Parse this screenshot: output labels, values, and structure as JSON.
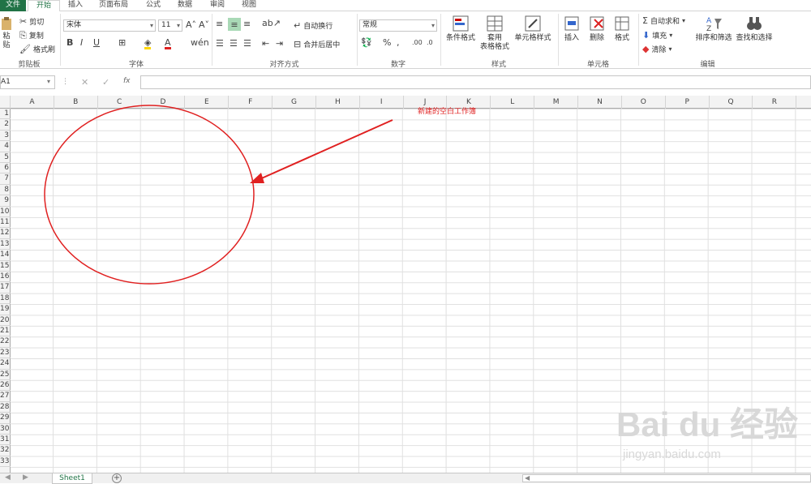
{
  "tabs": {
    "file": "文件",
    "home": "开始",
    "insert": "插入",
    "layout": "页面布局",
    "formula": "公式",
    "data": "数据",
    "review": "审阅",
    "view": "视图"
  },
  "clipboard": {
    "paste": "粘贴",
    "cut": "剪切",
    "copy": "复制",
    "painter": "格式刷",
    "group": "剪贴板"
  },
  "font": {
    "name": "宋体",
    "size": "11",
    "group": "字体"
  },
  "align": {
    "wrap": "自动换行",
    "merge": "合并后居中",
    "group": "对齐方式"
  },
  "number": {
    "format": "常规",
    "group": "数字"
  },
  "styles": {
    "cond": "条件格式",
    "table1": "套用",
    "table2": "表格格式",
    "cell": "单元格样式",
    "group": "样式"
  },
  "cells": {
    "insert": "插入",
    "delete": "删除",
    "format": "格式",
    "group": "单元格"
  },
  "edit": {
    "autosum": "自动求和",
    "fill": "填充",
    "clear": "清除",
    "sort": "排序和筛选",
    "find": "查找和选择",
    "group": "编辑"
  },
  "formula_bar": {
    "namebox": "A1",
    "fx": "fx"
  },
  "columns": [
    "A",
    "B",
    "C",
    "D",
    "E",
    "F",
    "G",
    "H",
    "I",
    "J",
    "K",
    "L",
    "M",
    "N",
    "O",
    "P",
    "Q",
    "R"
  ],
  "rows": [
    "1",
    "2",
    "3",
    "4",
    "5",
    "6",
    "7",
    "8",
    "9",
    "10",
    "11",
    "12",
    "13",
    "14",
    "15",
    "16",
    "17",
    "18",
    "19",
    "20",
    "21",
    "22",
    "23",
    "24",
    "25",
    "26",
    "27",
    "28",
    "29",
    "30",
    "31",
    "32",
    "33"
  ],
  "sheet": {
    "name": "Sheet1",
    "add": "+"
  },
  "annotation": {
    "note": "新建的空白工作簿",
    "color": "#e02020"
  },
  "watermark": {
    "brand": "Bai du 经验",
    "url": "jingyan.baidu.com"
  }
}
